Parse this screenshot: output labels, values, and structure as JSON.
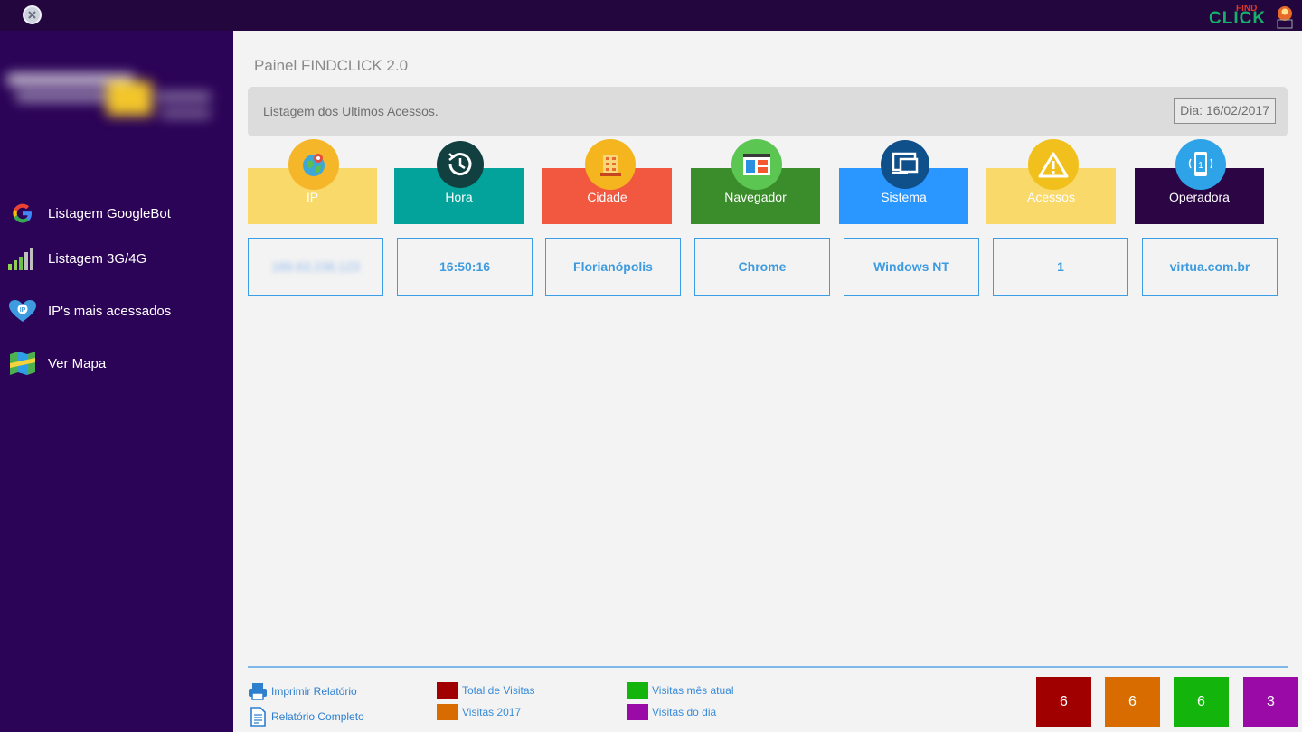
{
  "sidebar": {
    "items": [
      {
        "label": "Listagem GoogleBot",
        "icon": "google-icon"
      },
      {
        "label": "Listagem 3G/4G",
        "icon": "signal-bars-icon"
      },
      {
        "label": "IP's mais acessados",
        "icon": "ip-heart-icon"
      },
      {
        "label": "Ver Mapa",
        "icon": "map-icon"
      }
    ]
  },
  "main": {
    "title": "Painel FINDCLICK 2.0",
    "panel_label": "Listagem dos Ultimos Acessos.",
    "date": "Dia: 16/02/2017",
    "columns": [
      {
        "label": "IP",
        "color": "#f9d96a",
        "icon": "globe-pin-icon",
        "icon_bg": "#f5b62a"
      },
      {
        "label": "Hora",
        "color": "#03a39b",
        "icon": "clock-history-icon",
        "icon_bg": "#123f3f"
      },
      {
        "label": "Cidade",
        "color": "#f2573f",
        "icon": "building-icon",
        "icon_bg": "#f4b51f"
      },
      {
        "label": "Navegador",
        "color": "#3a8d2a",
        "icon": "browser-window-icon",
        "icon_bg": "#5cc653"
      },
      {
        "label": "Sistema",
        "color": "#2a96ff",
        "icon": "devices-icon",
        "icon_bg": "#0f4f8a"
      },
      {
        "label": "Acessos",
        "color": "#f9d96a",
        "icon": "warning-icon",
        "icon_bg": "#f2c01d"
      },
      {
        "label": "Operadora",
        "color": "#2c0545",
        "icon": "mobile-phone-icon",
        "icon_bg": "#2fa3e8"
      }
    ],
    "row": [
      "189.63.238.123",
      "16:50:16",
      "Florianópolis",
      "Chrome",
      "Windows NT",
      "1",
      "virtua.com.br"
    ]
  },
  "footer": {
    "print_label": "Imprimir Relatório",
    "report_label": "Relatório Completo",
    "legend": [
      {
        "label": "Total de Visitas",
        "color": "#a10000"
      },
      {
        "label": "Visitas 2017",
        "color": "#d96c00"
      },
      {
        "label": "Visitas mês atual",
        "color": "#13b50c"
      },
      {
        "label": "Visitas do dia",
        "color": "#9a0aa6"
      }
    ],
    "stats": [
      {
        "value": "6",
        "color": "#a10000"
      },
      {
        "value": "6",
        "color": "#d96c00"
      },
      {
        "value": "6",
        "color": "#13b50c"
      },
      {
        "value": "3",
        "color": "#9a0aa6"
      }
    ]
  }
}
